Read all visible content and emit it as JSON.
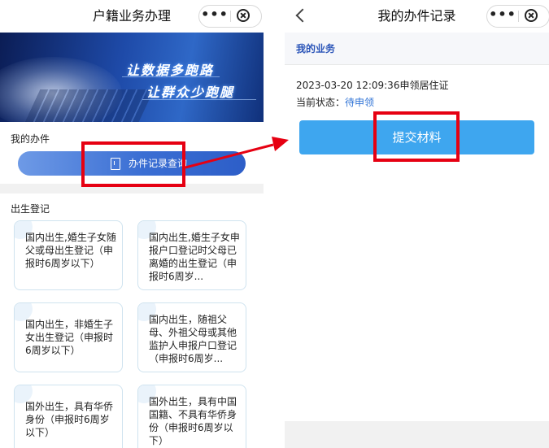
{
  "left": {
    "title": "户籍业务办理",
    "capsule_more": "•••",
    "banner": {
      "line1": "让数据多跑路",
      "line2": "让群众少跑腿"
    },
    "my_section_label": "我的办件",
    "query_button_label": "办件记录查询",
    "birth_section_label": "出生登记",
    "cards": [
      "国内出生,婚生子女随父或母出生登记（申报时6周岁以下）",
      "国内出生,婚生子女申报户口登记时父母已离婚的出生登记（申报时6周岁...",
      "国内出生，非婚生子女出生登记（申报时6周岁以下）",
      "国内出生，随祖父母、外祖父母或其他监护人申报户口登记（申报时6周岁...",
      "国外出生，具有华侨身份（申报时6周岁以下）",
      "国外出生，具有中国国籍、不具有华侨身份（申报时6周岁以下）"
    ]
  },
  "right": {
    "title": "我的办件记录",
    "capsule_more": "•••",
    "tab_label": "我的业务",
    "record_time": "2023-03-20 12:09:36申领居住证",
    "status_label": "当前状态：",
    "status_value": "待申领",
    "submit_label": "提交材料"
  },
  "colors": {
    "highlight": "#e60012",
    "primary_blue": "#3ea6ef",
    "link_blue": "#2f73d6"
  }
}
